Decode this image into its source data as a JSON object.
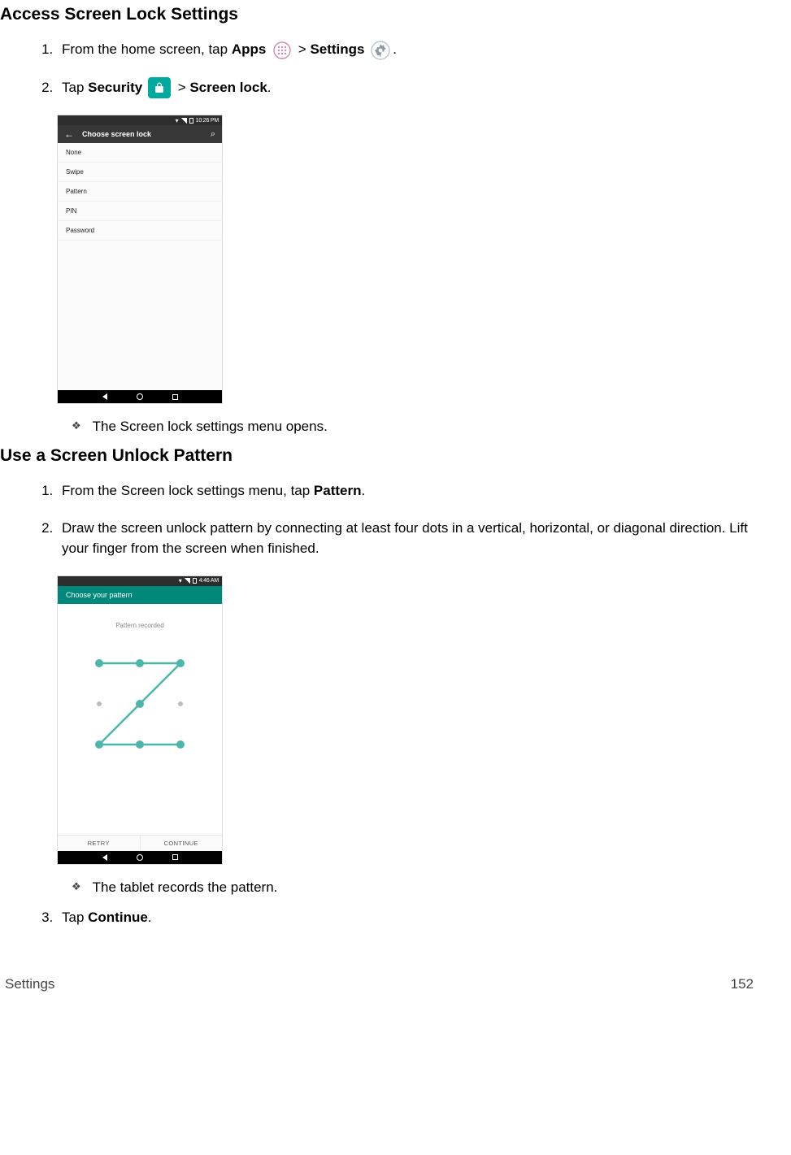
{
  "heading1": "Access Screen Lock Settings",
  "s1_step1_a": "From the home screen, tap ",
  "s1_step1_apps": "Apps",
  "s1_step1_gt1": " > ",
  "s1_step1_settings": "Settings",
  "s1_step1_end": ".",
  "s1_step2_a": "Tap ",
  "s1_step2_security": "Security",
  "s1_step2_gt": " > ",
  "s1_step2_screenlock": "Screen lock",
  "s1_step2_end": ".",
  "screenshot1": {
    "time": "10:26 PM",
    "back": "←",
    "title": "Choose screen lock",
    "search": "🔍",
    "options": [
      "None",
      "Swipe",
      "Pattern",
      "PIN",
      "Password"
    ]
  },
  "s1_result": "The Screen lock settings menu opens.",
  "heading2": "Use a Screen Unlock Pattern",
  "s2_step1_a": "From the Screen lock settings menu, tap ",
  "s2_step1_pattern": "Pattern",
  "s2_step1_end": ".",
  "s2_step2": "Draw the screen unlock pattern by connecting at least four dots in a vertical, horizontal, or diagonal direction. Lift your finger from the screen when finished.",
  "screenshot2": {
    "time": "4:46 AM",
    "title": "Choose your pattern",
    "msg": "Pattern recorded",
    "retry": "RETRY",
    "continue": "CONTINUE"
  },
  "s2_result": "The tablet records the pattern.",
  "s2_step3_a": "Tap ",
  "s2_step3_continue": "Continue",
  "s2_step3_end": ".",
  "footer_left": "Settings",
  "footer_right": "152"
}
